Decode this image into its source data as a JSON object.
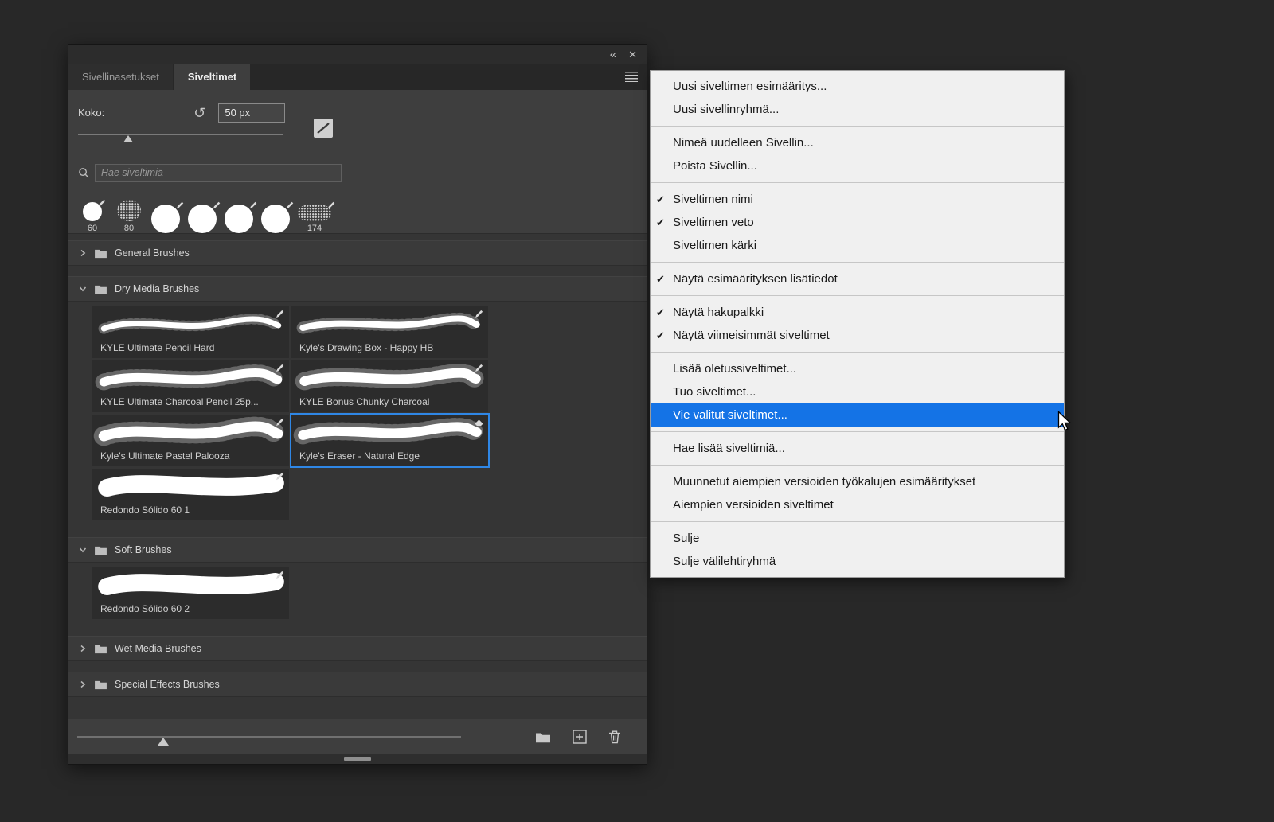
{
  "colors": {
    "menu_highlight": "#1473e6",
    "selection_border": "#2f87e6"
  },
  "panel": {
    "titlebar": {
      "collapse_icon": "«",
      "close_icon": "✕"
    },
    "tabs": [
      {
        "label": "Sivellinasetukset",
        "active": false
      },
      {
        "label": "Siveltimet",
        "active": true
      }
    ],
    "size": {
      "label": "Koko:",
      "value": "50 px"
    },
    "search": {
      "placeholder": "Hae siveltimiä"
    },
    "recents": [
      {
        "label": "60",
        "shape": "round-small",
        "badge": "pencil"
      },
      {
        "label": "80",
        "shape": "speckle",
        "badge": ""
      },
      {
        "label": "",
        "shape": "round-large",
        "badge": "pencil"
      },
      {
        "label": "",
        "shape": "round-large",
        "badge": "pencil"
      },
      {
        "label": "",
        "shape": "round-large",
        "badge": "pencil"
      },
      {
        "label": "",
        "shape": "round-large",
        "badge": "pencil"
      },
      {
        "label": "174",
        "shape": "speckle-wide",
        "badge": "pencil"
      }
    ],
    "groups": [
      {
        "label": "General Brushes",
        "expanded": false,
        "brushes": []
      },
      {
        "label": "Dry Media Brushes",
        "expanded": true,
        "brushes": [
          {
            "name": "KYLE Ultimate Pencil Hard",
            "style": "pencil",
            "badge": "pencil",
            "selected": false
          },
          {
            "name": "Kyle's Drawing Box - Happy HB",
            "style": "hb",
            "badge": "pencil",
            "selected": false
          },
          {
            "name": "KYLE Ultimate Charcoal Pencil 25p...",
            "style": "charcoal",
            "badge": "pencil",
            "selected": false
          },
          {
            "name": "KYLE Bonus Chunky Charcoal",
            "style": "chunky",
            "badge": "pencil",
            "selected": false
          },
          {
            "name": "Kyle's Ultimate Pastel Palooza",
            "style": "pastel",
            "badge": "pencil",
            "selected": false
          },
          {
            "name": "Kyle's Eraser - Natural Edge",
            "style": "eraser",
            "badge": "eraser",
            "selected": true
          },
          {
            "name": "Redondo Sólido 60 1",
            "style": "solid",
            "badge": "pencil",
            "selected": false
          }
        ]
      },
      {
        "label": "Soft Brushes",
        "expanded": true,
        "brushes": [
          {
            "name": "Redondo Sólido 60 2",
            "style": "solid",
            "badge": "pencil",
            "selected": false
          }
        ]
      },
      {
        "label": "Wet Media Brushes",
        "expanded": false,
        "brushes": []
      },
      {
        "label": "Special Effects Brushes",
        "expanded": false,
        "brushes": []
      }
    ]
  },
  "menu": {
    "items": [
      {
        "type": "item",
        "label": "Uusi siveltimen esimääritys...",
        "checked": false,
        "highlighted": false
      },
      {
        "type": "item",
        "label": "Uusi sivellinryhmä...",
        "checked": false,
        "highlighted": false
      },
      {
        "type": "separator"
      },
      {
        "type": "item",
        "label": "Nimeä uudelleen Sivellin...",
        "checked": false,
        "highlighted": false
      },
      {
        "type": "item",
        "label": "Poista Sivellin...",
        "checked": false,
        "highlighted": false
      },
      {
        "type": "separator"
      },
      {
        "type": "item",
        "label": "Siveltimen nimi",
        "checked": true,
        "highlighted": false
      },
      {
        "type": "item",
        "label": "Siveltimen veto",
        "checked": true,
        "highlighted": false
      },
      {
        "type": "item",
        "label": "Siveltimen kärki",
        "checked": false,
        "highlighted": false
      },
      {
        "type": "separator"
      },
      {
        "type": "item",
        "label": "Näytä esimäärityksen lisätiedot",
        "checked": true,
        "highlighted": false
      },
      {
        "type": "separator"
      },
      {
        "type": "item",
        "label": "Näytä hakupalkki",
        "checked": true,
        "highlighted": false
      },
      {
        "type": "item",
        "label": "Näytä viimeisimmät siveltimet",
        "checked": true,
        "highlighted": false
      },
      {
        "type": "separator"
      },
      {
        "type": "item",
        "label": "Lisää oletussiveltimet...",
        "checked": false,
        "highlighted": false
      },
      {
        "type": "item",
        "label": "Tuo siveltimet...",
        "checked": false,
        "highlighted": false
      },
      {
        "type": "item",
        "label": "Vie valitut siveltimet...",
        "checked": false,
        "highlighted": true
      },
      {
        "type": "separator"
      },
      {
        "type": "item",
        "label": "Hae lisää siveltimiä...",
        "checked": false,
        "highlighted": false
      },
      {
        "type": "separator"
      },
      {
        "type": "item",
        "label": "Muunnetut aiempien versioiden työkalujen esimääritykset",
        "checked": false,
        "highlighted": false
      },
      {
        "type": "item",
        "label": "Aiempien versioiden siveltimet",
        "checked": false,
        "highlighted": false
      },
      {
        "type": "separator"
      },
      {
        "type": "item",
        "label": "Sulje",
        "checked": false,
        "highlighted": false
      },
      {
        "type": "item",
        "label": "Sulje välilehtiryhmä",
        "checked": false,
        "highlighted": false
      }
    ]
  }
}
